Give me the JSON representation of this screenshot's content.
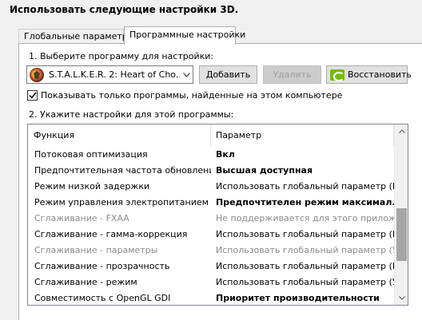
{
  "heading": "Использовать следующие настройки 3D.",
  "tabs": [
    {
      "label": "Глобальные параметры",
      "active": false
    },
    {
      "label": "Программные настройки",
      "active": true
    }
  ],
  "step1": {
    "label": "1. Выберите программу для настройки:"
  },
  "program_select": {
    "value": "S.T.A.L.K.E.R. 2: Heart of Cho...",
    "icon": "stalker-game-icon"
  },
  "buttons": {
    "add": "Добавить",
    "delete": "Удалить",
    "restore": "Восстановить"
  },
  "checkbox": {
    "label": "Показывать только программы, найденные на этом компьютере",
    "checked": true
  },
  "step2": {
    "label": "2. Укажите настройки для этой программы:"
  },
  "grid": {
    "headers": {
      "function": "Функция",
      "parameter": "Параметр"
    },
    "rows": [
      {
        "function": "Потоковая оптимизация",
        "parameter": "Вкл",
        "style": "bold"
      },
      {
        "function": "Предпочтительная частота обновлени...",
        "parameter": "Высшая доступная",
        "style": "bold"
      },
      {
        "function": "Режим низкой задержки",
        "parameter": "Использовать глобальный параметр (В...",
        "style": "normal"
      },
      {
        "function": "Режим управления электропитанием",
        "parameter": "Предпочтителен режим максимал...",
        "style": "bold"
      },
      {
        "function": "Сглаживание - FXAA",
        "parameter": "Не поддерживается для этого приложе...",
        "style": "grey"
      },
      {
        "function": "Сглаживание - гамма-коррекция",
        "parameter": "Использовать глобальный параметр (Вкл)",
        "style": "normal"
      },
      {
        "function": "Сглаживание - параметры",
        "parameter": "Использовать глобальный параметр (У...",
        "style": "grey"
      },
      {
        "function": "Сглаживание - прозрачность",
        "parameter": "Использовать глобальный параметр (В...",
        "style": "normal"
      },
      {
        "function": "Сглаживание - режим",
        "parameter": "Использовать глобальный параметр (У...",
        "style": "normal"
      },
      {
        "function": "Совместимость с OpenGL GDI",
        "parameter": "Приоритет производительности",
        "style": "bold"
      }
    ]
  },
  "colors": {
    "nvidia_green": "#76b900",
    "disabled_text": "#a0a0a0",
    "grey_row": "#8a8a8a"
  }
}
